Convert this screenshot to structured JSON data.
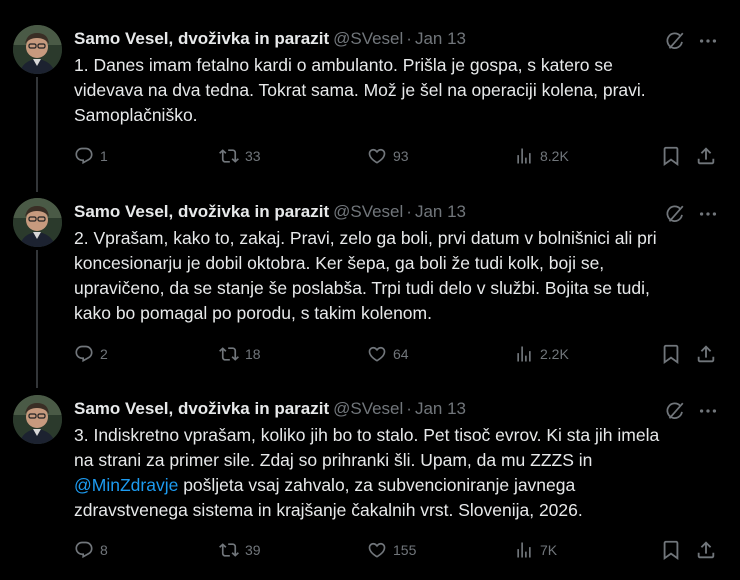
{
  "tweets": [
    {
      "author_name": "Samo Vesel, dvoživka in parazit",
      "handle": "@SVesel",
      "separator": "·",
      "date": "Jan 13",
      "text": "1. Danes imam fetalno kardi o ambulanto. Prišla je gospa, s katero se\nvidevava na dva tedna. Tokrat sama. Mož je šel na operaciji kolena, pravi.\nSamoplačniško.",
      "replies": "1",
      "reposts": "33",
      "likes": "93",
      "views": "8.2K"
    },
    {
      "author_name": "Samo Vesel, dvoživka in parazit",
      "handle": "@SVesel",
      "separator": "·",
      "date": "Jan 13",
      "text": "2. Vprašam, kako to, zakaj. Pravi, zelo ga boli, prvi datum v bolnišnici ali pri\nkoncesionarju je dobil oktobra. Ker šepa, ga boli že tudi kolk, boji se,\nupravičeno, da se stanje še poslabša. Trpi tudi delo v službi. Bojita se tudi,\nkako bo pomagal po porodu, s takim kolenom.",
      "replies": "2",
      "reposts": "18",
      "likes": "64",
      "views": "2.2K"
    },
    {
      "author_name": "Samo Vesel, dvoživka in parazit",
      "handle": "@SVesel",
      "separator": "·",
      "date": "Jan 13",
      "text_before": "3. Indiskretno vprašam, koliko jih bo to stalo. Pet tisoč evrov. Ki sta jih imela\nna strani za primer sile. Zdaj so prihranki šli. Upam, da mu ZZZS in\n",
      "mention": "@MinZdravje",
      "text_after": " pošljeta vsaj zahvalo, za subvencioniranje javnega\nzdravstvenega sistema in krajšanje čakalnih vrst. Slovenija, 2026.",
      "replies": "8",
      "reposts": "39",
      "likes": "155",
      "views": "7K"
    }
  ],
  "icons": {
    "grok": "grok-icon",
    "more": "more-icon",
    "reply": "reply-icon",
    "repost": "repost-icon",
    "like": "like-icon",
    "views": "views-icon",
    "bookmark": "bookmark-icon",
    "share": "share-icon"
  },
  "colors": {
    "background": "#000000",
    "text": "#e7e9ea",
    "muted": "#71767b",
    "link": "#1d9bf0"
  }
}
